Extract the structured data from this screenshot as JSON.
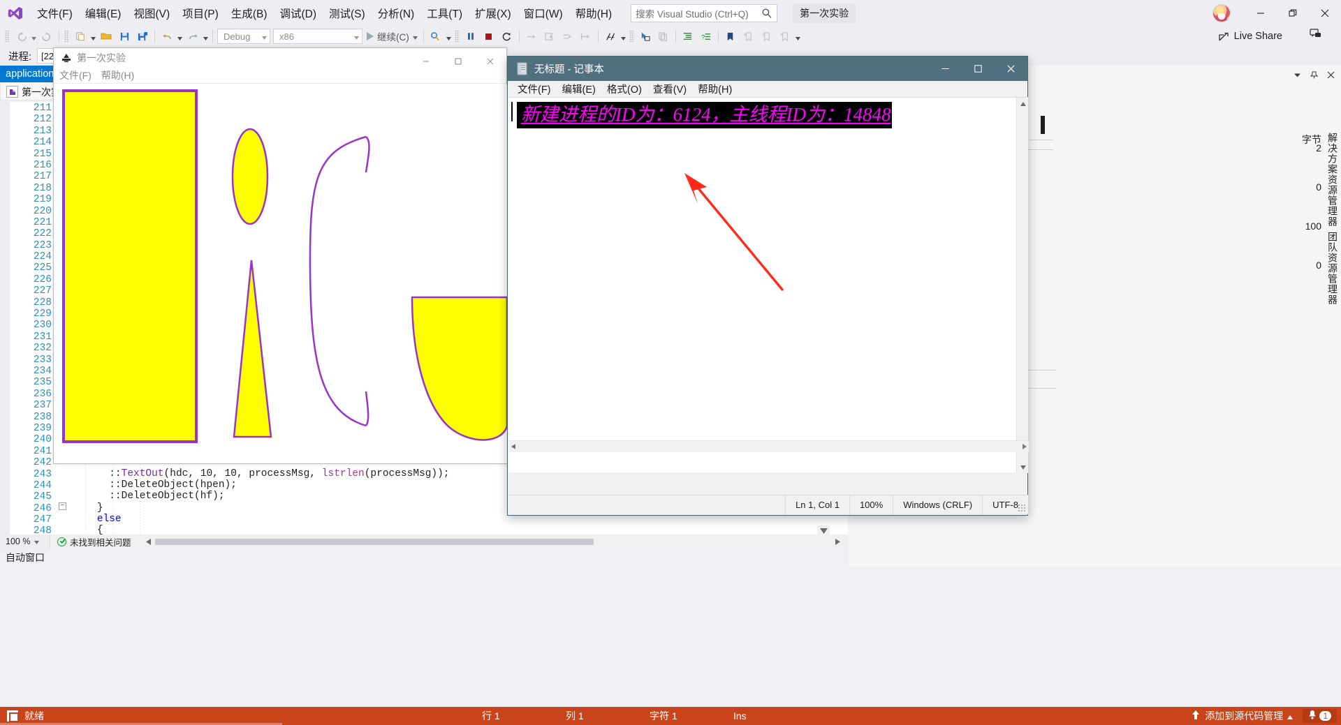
{
  "vs": {
    "menu_items": [
      "文件(F)",
      "编辑(E)",
      "视图(V)",
      "项目(P)",
      "生成(B)",
      "调试(D)",
      "测试(S)",
      "分析(N)",
      "工具(T)",
      "扩展(X)",
      "窗口(W)",
      "帮助(H)"
    ],
    "search_placeholder": "搜索 Visual Studio (Ctrl+Q)",
    "project_tag": "第一次实验",
    "live_share": "Live Share",
    "toolbar": {
      "config": "Debug",
      "platform": "x86",
      "run_label": "继续(C)"
    },
    "process": {
      "label": "进程:",
      "value": "[22"
    },
    "solution_tab": "application",
    "doc_tab": "第一次实",
    "editor": {
      "line_numbers": [
        211,
        212,
        213,
        214,
        215,
        216,
        217,
        218,
        219,
        220,
        221,
        222,
        223,
        224,
        225,
        226,
        227,
        228,
        229,
        230,
        231,
        232,
        233,
        234,
        235,
        236,
        237,
        238,
        239,
        240,
        241,
        242,
        243,
        244,
        245,
        246,
        247,
        248
      ],
      "code_lines": [
        {
          "n": 243,
          "indent": 6,
          "parts": [
            {
              "t": "::",
              "c": "plain"
            },
            {
              "t": "TextOut",
              "c": "fn"
            },
            {
              "t": "(hdc, 10, 10, processMsg, ",
              "c": "plain"
            },
            {
              "t": "lstrlen",
              "c": "fn2"
            },
            {
              "t": "(processMsg));",
              "c": "plain"
            }
          ]
        },
        {
          "n": 244,
          "indent": 6,
          "parts": [
            {
              "t": "::DeleteObject(hpen);",
              "c": "plain"
            }
          ]
        },
        {
          "n": 245,
          "indent": 6,
          "parts": [
            {
              "t": "::DeleteObject(hf);",
              "c": "plain"
            }
          ]
        },
        {
          "n": 246,
          "indent": 4,
          "parts": [
            {
              "t": "}",
              "c": "plain"
            }
          ]
        },
        {
          "n": 247,
          "indent": 4,
          "parts": [
            {
              "t": "else",
              "c": "kw"
            }
          ]
        },
        {
          "n": 248,
          "indent": 4,
          "parts": [
            {
              "t": "{",
              "c": "plain"
            }
          ]
        }
      ],
      "zoom": "100 %",
      "issues": "未找到相关问题"
    },
    "auto_window": "自动窗口",
    "status": {
      "ready": "就绪",
      "row_label": "行 1",
      "col_label": "列 1",
      "char_label": "字符 1",
      "ins_label": "Ins",
      "source_control": "添加到源代码管理",
      "notif_count": "1"
    },
    "right_panel": {
      "vertical_label_1": "解决方案资源管理器",
      "vertical_label_2": "团队资源管理器",
      "unit": "字节",
      "values": [
        "2",
        "0",
        "100",
        "0"
      ]
    }
  },
  "app_window": {
    "title": "第一次实验",
    "menu": [
      "文件(F)",
      "帮助(H)"
    ],
    "shape_fill": "#ffff00",
    "shape_stroke": "#9933cc"
  },
  "notepad": {
    "title": "无标题 - 记事本",
    "menu": [
      "文件(F)",
      "编辑(E)",
      "格式(O)",
      "查看(V)",
      "帮助(H)"
    ],
    "content": "新建进程的ID为：6124，主线程ID为：14848",
    "text_color": "#ff00ff",
    "text_background": "#000000",
    "status": {
      "position": "Ln 1,  Col 1",
      "zoom": "100%",
      "line_ending": "Windows (CRLF)",
      "encoding": "UTF-8"
    }
  },
  "annotation": {
    "arrow_color": "#ff2a1a"
  }
}
